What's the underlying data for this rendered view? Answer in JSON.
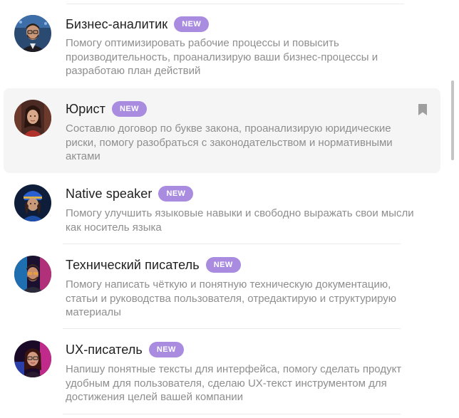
{
  "assistants": [
    {
      "title": "Бизнес-аналитик",
      "badge": "NEW",
      "description": "Помогу оптимизировать рабочие процессы и повысить производительность, проанализирую ваши бизнес-процессы и разработаю план действий",
      "avatar_icon": "business-analyst-avatar",
      "highlighted": false
    },
    {
      "title": "Юрист",
      "badge": "NEW",
      "description": "Составлю договор по букве закона, проанализирую юридические риски, помогу разобраться с законодательством и нормативными актами",
      "avatar_icon": "lawyer-avatar",
      "highlighted": true,
      "bookmark_icon": "bookmark-icon"
    },
    {
      "title": "Native speaker",
      "badge": "NEW",
      "description": "Помогу улучшить языковые навыки и свободно выражать свои мысли как носитель языка",
      "avatar_icon": "native-speaker-avatar",
      "highlighted": false
    },
    {
      "title": "Технический писатель",
      "badge": "NEW",
      "description": "Помогу написать чёткую и понятную техническую документацию, статьи и руководства пользователя, отредактирую и структурирую материалы",
      "avatar_icon": "technical-writer-avatar",
      "highlighted": false
    },
    {
      "title": "UX-писатель",
      "badge": "NEW",
      "description": "Напишу понятные тексты для интерфейса, помогу сделать продукт удобным для пользователя, сделаю UX-текст инструментом для достижения целей вашей компании",
      "avatar_icon": "ux-writer-avatar",
      "highlighted": false
    }
  ],
  "colors": {
    "badge_bg": "#a98ce0",
    "title": "#1f1f1f",
    "description": "#8e8e8e",
    "highlight_bg": "#f5f5f5"
  }
}
